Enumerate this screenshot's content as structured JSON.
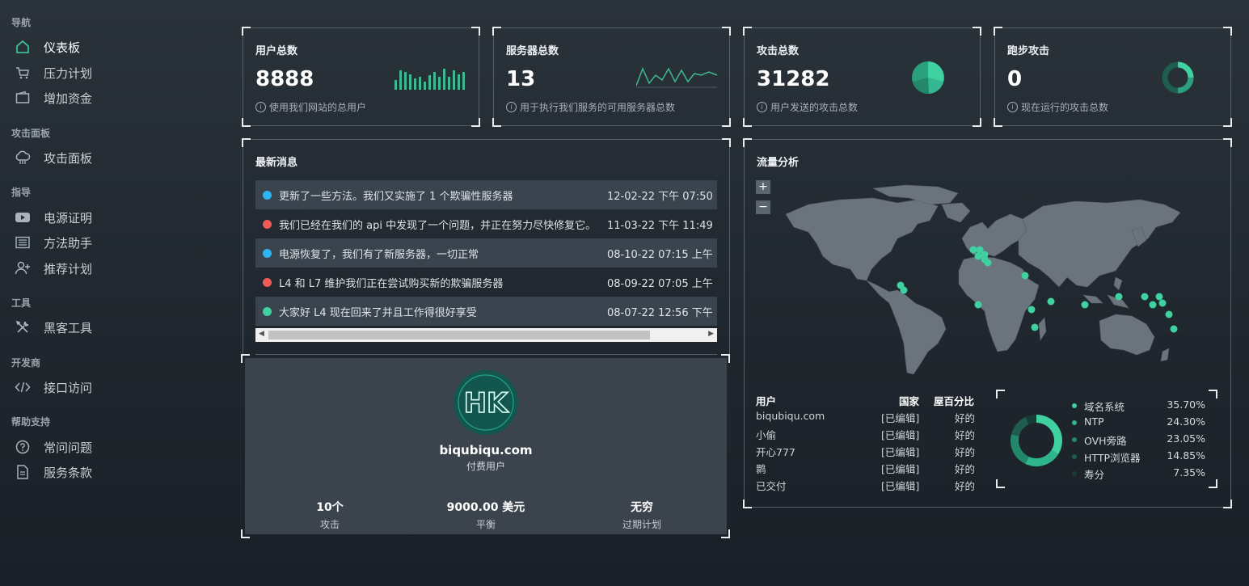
{
  "sidebar": {
    "sections": [
      {
        "title": "导航",
        "items": [
          {
            "label": "仪表板",
            "icon": "home-icon",
            "active": true
          },
          {
            "label": "压力计划",
            "icon": "cart-icon"
          },
          {
            "label": "增加资金",
            "icon": "wallet-icon"
          }
        ]
      },
      {
        "title": "攻击面板",
        "items": [
          {
            "label": "攻击面板",
            "icon": "cloud-icon"
          }
        ]
      },
      {
        "title": "指导",
        "items": [
          {
            "label": "电源证明",
            "icon": "youtube-icon"
          },
          {
            "label": "方法助手",
            "icon": "list-icon"
          },
          {
            "label": "推荐计划",
            "icon": "user-plus-icon"
          }
        ]
      },
      {
        "title": "工具",
        "items": [
          {
            "label": "黑客工具",
            "icon": "tools-icon"
          }
        ]
      },
      {
        "title": "开发商",
        "items": [
          {
            "label": "接口访问",
            "icon": "code-icon"
          }
        ]
      },
      {
        "title": "帮助支持",
        "items": [
          {
            "label": "常问问题",
            "icon": "help-icon"
          },
          {
            "label": "服务条款",
            "icon": "document-icon"
          }
        ]
      }
    ]
  },
  "stats": [
    {
      "title": "用户总数",
      "value": "8888",
      "desc": "使用我们网站的总用户",
      "chart": "bar-sparkline"
    },
    {
      "title": "服务器总数",
      "value": "13",
      "desc": "用于执行我们服务的可用服务器总数",
      "chart": "line-sparkline"
    },
    {
      "title": "攻击总数",
      "value": "31282",
      "desc": "用户发送的攻击总数",
      "chart": "pie"
    },
    {
      "title": "跑步攻击",
      "value": "0",
      "desc": "现在运行的攻击总数",
      "chart": "ring"
    }
  ],
  "news": {
    "title": "最新消息",
    "items": [
      {
        "text": "更新了一些方法。我们又实施了 1 个欺骗性服务器",
        "date": "12-02-22 下午 07:50",
        "color": "#2fb5f5"
      },
      {
        "text": "我们已经在我们的 api 中发现了一个问题，并正在努力尽快修复它。",
        "date": "11-03-22 下午 11:49",
        "color": "#f25a5a"
      },
      {
        "text": "电源恢复了，我们有了新服务器，一切正常",
        "date": "08-10-22 07:15 上午",
        "color": "#2fb5f5"
      },
      {
        "text": "L4 和 L7 维护我们正在尝试购买新的欺骗服务器",
        "date": "08-09-22 07:05 上午",
        "color": "#f25a5a"
      },
      {
        "text": "大家好 L4 现在回来了并且工作得很好享受",
        "date": "08-07-22 12:56 下午",
        "color": "#3fd1a0"
      }
    ]
  },
  "profile": {
    "avatar_text": "HK",
    "name": "biqubiqu.com",
    "type": "付费用户",
    "stats": [
      {
        "value": "10个",
        "label": "攻击"
      },
      {
        "value": "9000.00 美元",
        "label": "平衡"
      },
      {
        "value": "无穷",
        "label": "过期计划"
      }
    ]
  },
  "traffic": {
    "title": "流量分析",
    "zoom_in": "+",
    "zoom_out": "−",
    "table_headers": {
      "user": "用户",
      "country": "国家",
      "percent": "屋百分比"
    },
    "rows": [
      {
        "user": "biqubiqu.com",
        "country": "[已编辑]",
        "percent": "好的"
      },
      {
        "user": "小偷",
        "country": "[已编辑]",
        "percent": "好的"
      },
      {
        "user": "开心777",
        "country": "[已编辑]",
        "percent": "好的"
      },
      {
        "user": "鹮",
        "country": "[已编辑]",
        "percent": "好的"
      },
      {
        "user": "已交付",
        "country": "[已编辑]",
        "percent": "好的"
      }
    ],
    "legend": [
      {
        "label": "域名系统",
        "percent": "35.70%",
        "value": 35.7,
        "color": "#3fd1a0"
      },
      {
        "label": "NTP",
        "percent": "24.30%",
        "value": 24.3,
        "color": "#2fb58a"
      },
      {
        "label": "OVH旁路",
        "percent": "23.05%",
        "value": 23.05,
        "color": "#23876a"
      },
      {
        "label": "HTTP浏览器",
        "percent": "14.85%",
        "value": 14.85,
        "color": "#1f5e4e"
      },
      {
        "label": "寿分",
        "percent": "7.35%",
        "value": 7.35,
        "color": "#1b3b36"
      }
    ]
  },
  "colors": {
    "accent": "#3fd1a0",
    "blue": "#2fb5f5",
    "red": "#f25a5a"
  }
}
